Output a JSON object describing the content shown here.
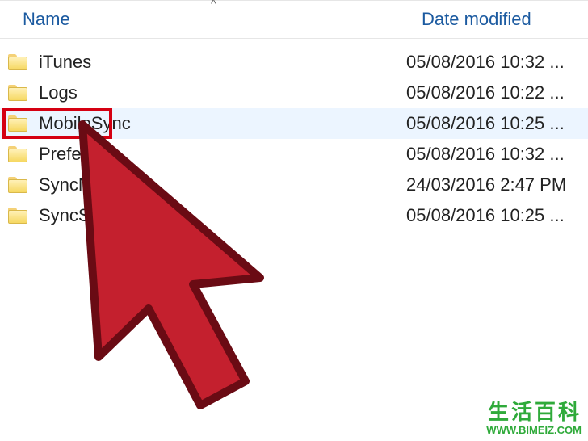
{
  "headers": {
    "name": "Name",
    "date": "Date modified"
  },
  "sort_indicator": "^",
  "rows": [
    {
      "name": "iTunes",
      "date": "05/08/2016 10:32 ...",
      "selected": false
    },
    {
      "name": "Logs",
      "date": "05/08/2016 10:22 ...",
      "selected": false
    },
    {
      "name": "MobileSync",
      "date": "05/08/2016 10:25 ...",
      "selected": true
    },
    {
      "name": "Preferen",
      "date": "05/08/2016 10:32 ...",
      "selected": false
    },
    {
      "name": "SyncNotif",
      "date": "24/03/2016 2:47 PM",
      "selected": false
    },
    {
      "name": "SyncServices",
      "date": "05/08/2016 10:25 ...",
      "selected": false
    }
  ],
  "highlight_row_index": 2,
  "watermark": {
    "line1": "生活百科",
    "line2": "WWW.BIMEIZ.COM"
  },
  "colors": {
    "header_text": "#1b5aa0",
    "selection_bg": "#ecf5ff",
    "highlight_border": "#d50012",
    "cursor_fill": "#c4202e",
    "cursor_stroke": "#6a0b14",
    "watermark": "#2faa3a"
  }
}
